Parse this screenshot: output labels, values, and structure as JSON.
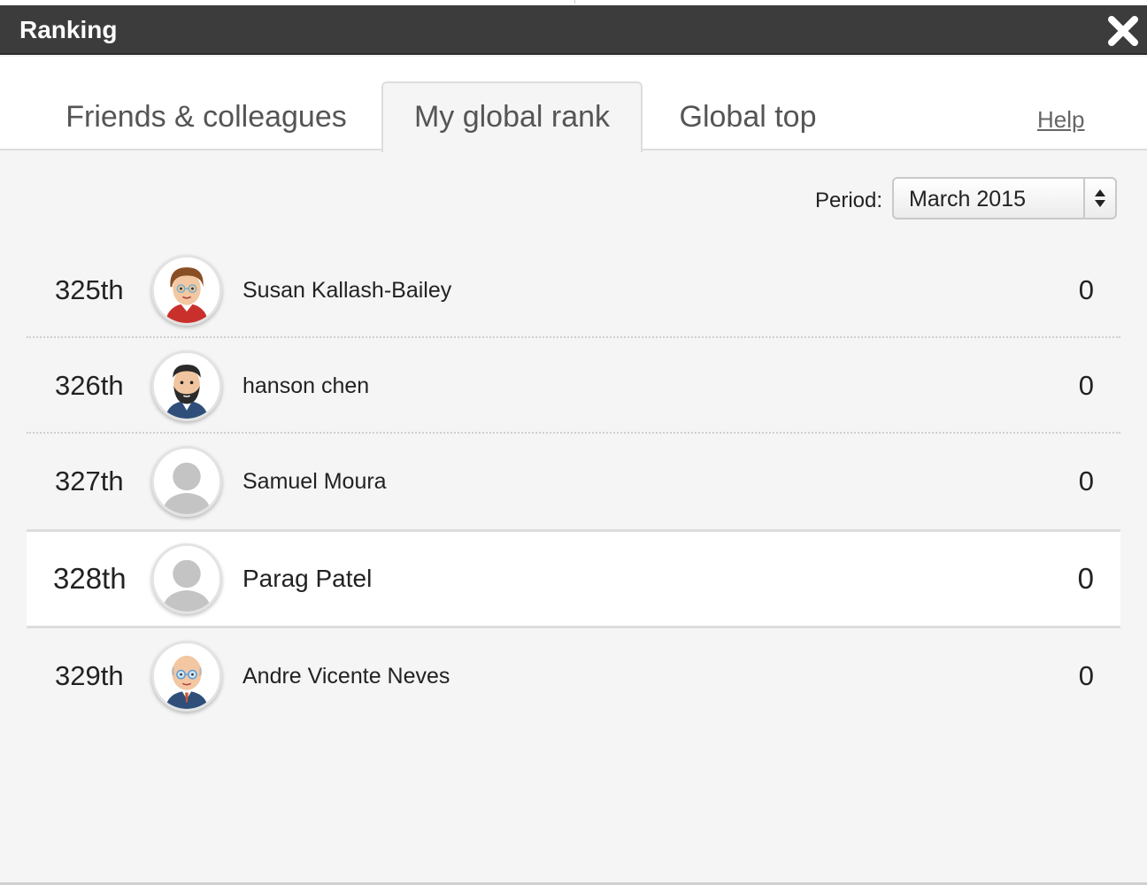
{
  "dialog": {
    "title": "Ranking",
    "close_icon": "close-icon"
  },
  "tabs": [
    {
      "label": "Friends & colleagues",
      "active": false
    },
    {
      "label": "My global rank",
      "active": true
    },
    {
      "label": "Global top",
      "active": false
    }
  ],
  "help": {
    "label": "Help"
  },
  "period": {
    "label": "Period:",
    "selected": "March 2015"
  },
  "ranking": [
    {
      "rank": "325th",
      "name": "Susan Kallash-Bailey",
      "score": "0",
      "avatar": "female-avatar-icon",
      "current": false
    },
    {
      "rank": "326th",
      "name": "hanson chen",
      "score": "0",
      "avatar": "bearded-man-avatar-icon",
      "current": false
    },
    {
      "rank": "327th",
      "name": "Samuel Moura",
      "score": "0",
      "avatar": "default-user-icon",
      "current": false
    },
    {
      "rank": "328th",
      "name": "Parag Patel",
      "score": "0",
      "avatar": "default-user-icon",
      "current": true
    },
    {
      "rank": "329th",
      "name": "Andre Vicente Neves",
      "score": "0",
      "avatar": "bald-man-glasses-avatar-icon",
      "current": false
    }
  ],
  "colors": {
    "titlebar_bg": "#3c3c3c",
    "dialog_bg": "#f5f5f5",
    "current_row_bg": "#ffffff"
  }
}
